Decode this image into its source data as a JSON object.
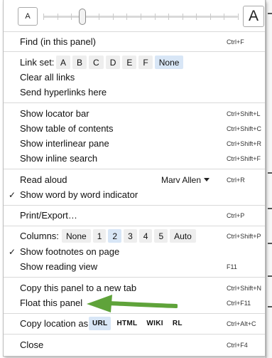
{
  "font_size": {
    "small_label": "A",
    "large_label": "A",
    "level": 0.2
  },
  "menu": {
    "find": {
      "label": "Find (in this panel)",
      "shortcut": "Ctrl+F"
    },
    "link_set": {
      "label": "Link set:",
      "options": [
        "A",
        "B",
        "C",
        "D",
        "E",
        "F",
        "None"
      ],
      "selected": "None"
    },
    "clear_links": {
      "label": "Clear all links"
    },
    "send_hyperlinks": {
      "label": "Send hyperlinks here"
    },
    "locator_bar": {
      "label": "Show locator bar",
      "shortcut": "Ctrl+Shift+L"
    },
    "toc": {
      "label": "Show table of contents",
      "shortcut": "Ctrl+Shift+C"
    },
    "interlinear": {
      "label": "Show interlinear pane",
      "shortcut": "Ctrl+Shift+R"
    },
    "inline_search": {
      "label": "Show inline search",
      "shortcut": "Ctrl+Shift+F"
    },
    "read_aloud": {
      "label": "Read aloud",
      "voice": "Marv Allen",
      "shortcut": "Ctrl+R"
    },
    "word_indicator": {
      "label": "Show word by word indicator",
      "checked": true
    },
    "print": {
      "label": "Print/Export…",
      "shortcut": "Ctrl+P"
    },
    "columns": {
      "label": "Columns:",
      "options": [
        "None",
        "1",
        "2",
        "3",
        "4",
        "5",
        "Auto"
      ],
      "selected": "2",
      "shortcut": "Ctrl+Shift+P"
    },
    "footnotes": {
      "label": "Show footnotes on page",
      "checked": true
    },
    "reading_view": {
      "label": "Show reading view",
      "shortcut": "F11"
    },
    "copy_tab": {
      "label": "Copy this panel to a new tab",
      "shortcut": "Ctrl+Shift+N"
    },
    "float": {
      "label": "Float this panel",
      "shortcut": "Ctrl+F11"
    },
    "copy_location": {
      "label": "Copy location as:",
      "options": [
        "URL",
        "HTML",
        "WIKI",
        "RL"
      ],
      "selected": "URL",
      "shortcut": "Ctrl+Alt+C"
    },
    "close": {
      "label": "Close",
      "shortcut": "Ctrl+F4"
    }
  },
  "colors": {
    "selected_chip": "#d8e6f6",
    "chip": "#eeeeee",
    "arrow": "#5fa33a"
  },
  "icons": {
    "checkmark": "checkmark-icon",
    "dropdown": "chevron-down-icon",
    "annotation": "arrow-left-icon"
  }
}
